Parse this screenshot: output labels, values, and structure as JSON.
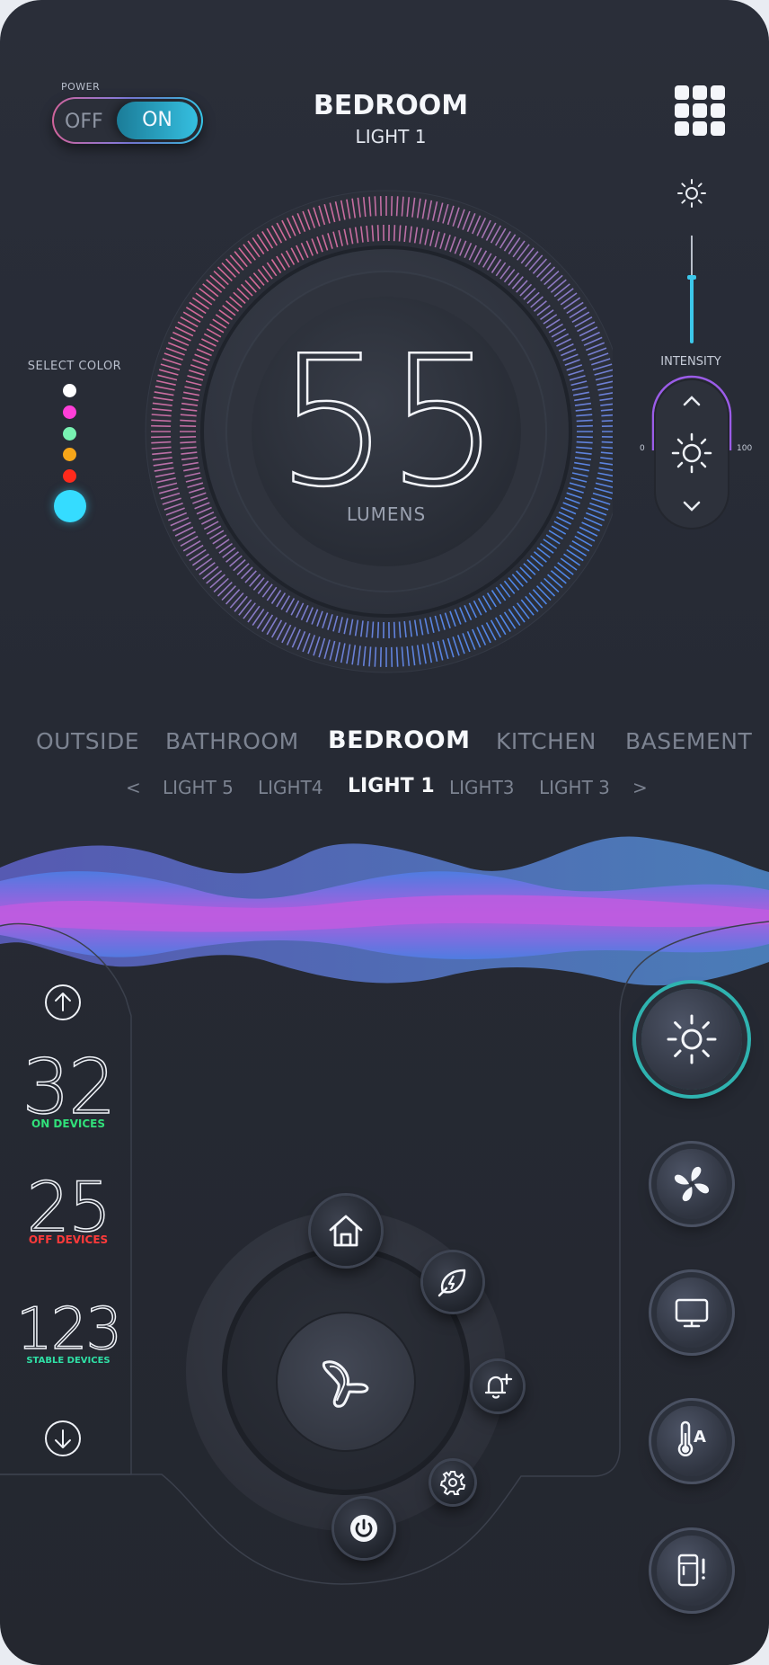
{
  "header": {
    "power_label": "POWER",
    "power_off": "OFF",
    "power_on": "ON",
    "power_state": "on",
    "title": "BEDROOM",
    "subtitle": "LIGHT 1"
  },
  "dial": {
    "value": "55",
    "unit": "LUMENS"
  },
  "color_select": {
    "label": "SELECT COLOR",
    "colors": [
      "#ffffff",
      "#ff3fd8",
      "#78f2b2",
      "#f7a619",
      "#ff2a1c",
      "#35dcff"
    ],
    "selected": "#35dcff"
  },
  "intensity": {
    "label": "INTENSITY",
    "min": "0",
    "max": "100",
    "slider_level": 0.4
  },
  "rooms": {
    "items": [
      "OUTSIDE",
      "BATHROOM",
      "BEDROOM",
      "KITCHEN",
      "BASEMENT"
    ],
    "active": "BEDROOM"
  },
  "lights": {
    "prev": "<",
    "items": [
      "LIGHT 5",
      "LIGHT4",
      "LIGHT 1",
      "LIGHT3",
      "LIGHT 3"
    ],
    "active": "LIGHT 1",
    "next": ">"
  },
  "stats": {
    "on_value": "32",
    "on_label": "ON DEVICES",
    "off_value": "25",
    "off_label": "OFF DEVICES",
    "stable_value": "123",
    "stable_label": "STABLE DEVICES"
  },
  "devices": [
    "sun-icon",
    "fan-icon",
    "monitor-icon",
    "thermometer-icon",
    "fridge-alert-icon"
  ],
  "wheel": [
    "home-icon",
    "eco-energy-icon",
    "bell-plus-icon",
    "gear-icon",
    "power-icon",
    "fan-blade-icon"
  ],
  "accent_colors": {
    "pink": "#d0639a",
    "blue": "#5b8de8",
    "teal": "#2fb3b0",
    "cyan": "#35c3e6",
    "purple": "#9b4fe0",
    "on_green": "#31e07a",
    "off_red": "#ff3a3a",
    "stable_teal": "#2fe1a6"
  }
}
